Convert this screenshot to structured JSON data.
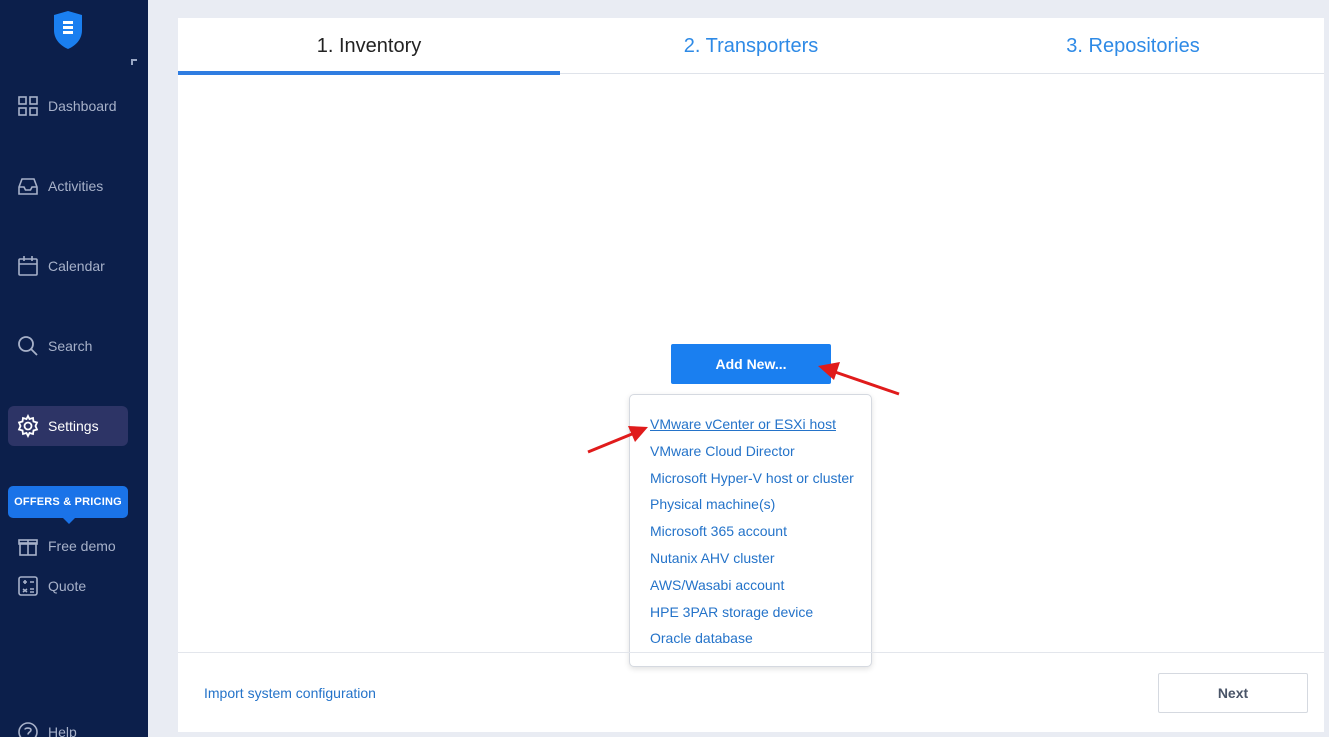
{
  "sidebar": {
    "items": [
      {
        "label": "Dashboard",
        "icon": "dashboard-grid-icon"
      },
      {
        "label": "Activities",
        "icon": "inbox-tray-icon"
      },
      {
        "label": "Calendar",
        "icon": "calendar-icon"
      },
      {
        "label": "Search",
        "icon": "search-icon"
      },
      {
        "label": "Settings",
        "icon": "gear-icon",
        "active": true
      }
    ],
    "offers_label": "OFFERS & PRICING",
    "free_demo_label": "Free demo",
    "quote_label": "Quote",
    "help_label": "Help"
  },
  "tabs": [
    {
      "label": "1. Inventory",
      "active": true
    },
    {
      "label": "2. Transporters"
    },
    {
      "label": "3. Repositories"
    }
  ],
  "add_new_label": "Add New...",
  "dropdown_items": [
    "VMware vCenter or ESXi host",
    "VMware Cloud Director",
    "Microsoft Hyper-V host or cluster",
    "Physical machine(s)",
    "Microsoft 365 account",
    "Nutanix AHV cluster",
    "AWS/Wasabi account",
    "HPE 3PAR storage device",
    "Oracle database"
  ],
  "import_label": "Import system configuration",
  "next_label": "Next",
  "colors": {
    "sidebar_bg": "#0c1f4b",
    "accent": "#1a7ff0",
    "link": "#2473c9",
    "annotation_arrow": "#e01b1b"
  }
}
